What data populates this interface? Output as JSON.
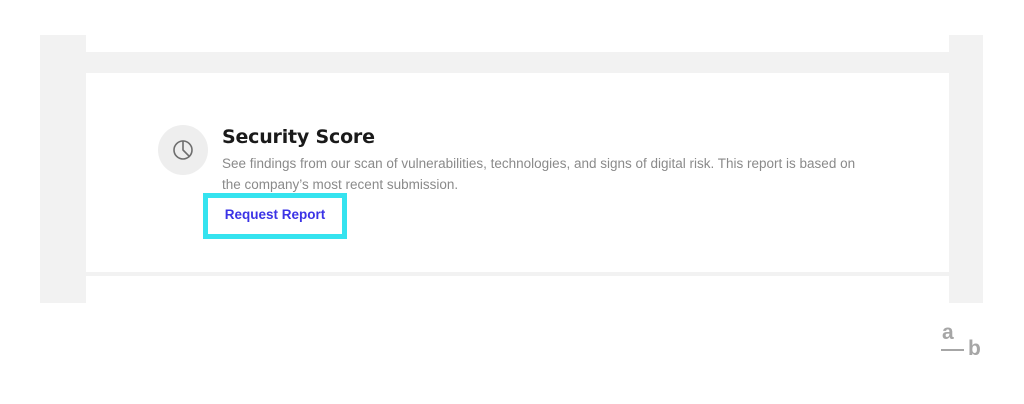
{
  "security_card": {
    "icon": "pie-chart-icon",
    "title": "Security Score",
    "description": "See findings from our scan of vulnerabilities, technologies, and signs of digital risk. This report is based on the company’s most recent submission.",
    "action_label": "Request Report",
    "highlight_color": "#35e3ef",
    "link_color": "#3b33e6"
  },
  "logo": {
    "top_letter": "a",
    "bottom_letter": "b"
  }
}
